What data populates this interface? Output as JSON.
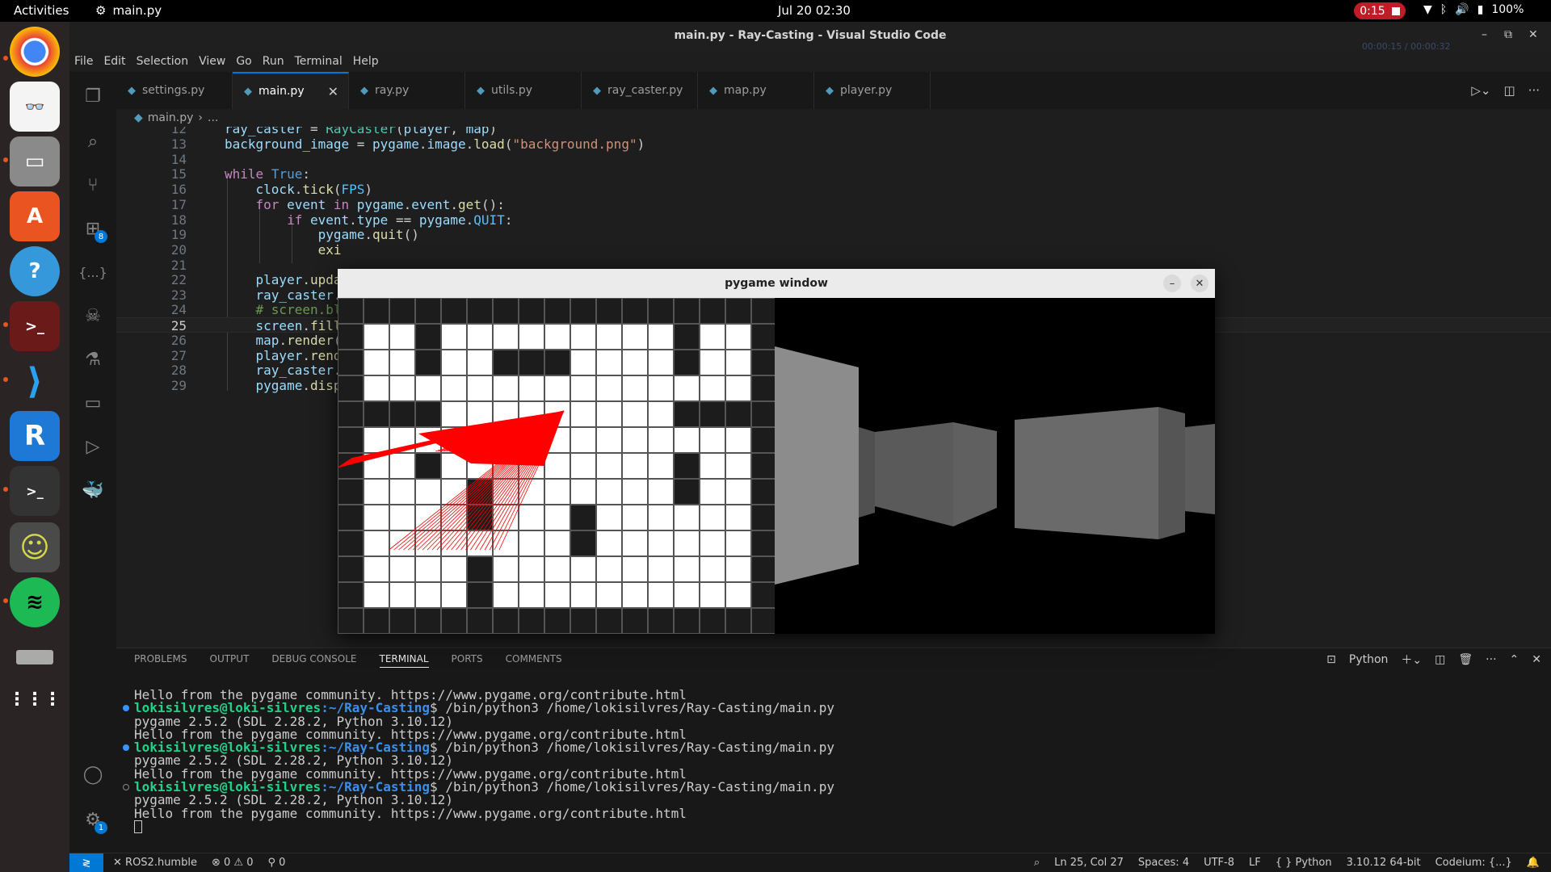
{
  "topbar": {
    "activities": "Activities",
    "app_name": "main.py",
    "clock": "Jul 20  02:30",
    "recording": "0:15",
    "battery": "100%"
  },
  "window": {
    "title": "main.py - Ray-Casting - Visual Studio Code",
    "timer": "00:00:15 / 00:00:32"
  },
  "menu": [
    "File",
    "Edit",
    "Selection",
    "View",
    "Go",
    "Run",
    "Terminal",
    "Help"
  ],
  "tabs": [
    "settings.py",
    "main.py",
    "ray.py",
    "utils.py",
    "ray_caster.py",
    "map.py",
    "player.py"
  ],
  "breadcrumb": {
    "file": "main.py",
    "more": "..."
  },
  "code": {
    "line_numbers": [
      "12",
      "13",
      "14",
      "15",
      "16",
      "17",
      "18",
      "19",
      "20",
      "21",
      "22",
      "23",
      "24",
      "25",
      "26",
      "27",
      "28",
      "29"
    ]
  },
  "pygame": {
    "title": "pygame window",
    "map": [
      "BBBBBBBBBBBBBBBBB",
      "BWWBWWWWWWWWWBWWB",
      "BWWBWWBBBWWWWBWWB",
      "BWWWWWWWWWWWWWWWB",
      "BBBBWWWWWWWWWBBBB",
      "BWWWWBWWWWWWWWWWB",
      "BWWBWWWWWWWWWBWWB",
      "BWWWWBWWWWWWWBWWB",
      "BWWWWBWWWBWWWWWWB",
      "BWWWWWWWWBWWWWWWB",
      "BWWWWBWWWWWWWWWWB",
      "BWWWWBWWWWWWWWWWB",
      "BBBBBBBBBBBBBBBBB"
    ]
  },
  "panel": {
    "tabs": [
      "PROBLEMS",
      "OUTPUT",
      "DEBUG CONSOLE",
      "TERMINAL",
      "PORTS",
      "COMMENTS"
    ],
    "shell": "Python"
  },
  "terminal": {
    "hello": "Hello from the pygame community. https://www.pygame.org/contribute.html",
    "user": "lokisilvres@loki-silvres",
    "path": ":~/Ray-Casting",
    "cmd": "$ /bin/python3 /home/lokisilvres/Ray-Casting/main.py",
    "version": "pygame 2.5.2 (SDL 2.28.2, Python 3.10.12)"
  },
  "status": {
    "ros": "ROS2.humble",
    "errors": "0",
    "warnings": "0",
    "ports": "0",
    "position": "Ln 25, Col 27",
    "spaces": "Spaces: 4",
    "encoding": "UTF-8",
    "eol": "LF",
    "language": "Python",
    "interpreter": "3.10.12 64-bit",
    "codeium": "Codeium: {...}"
  },
  "dock_icons": [
    "chrome-icon",
    "document-viewer-icon",
    "files-icon",
    "app-center-icon",
    "help-icon",
    "terminal-red-icon",
    "vscode-icon",
    "rustdesk-icon",
    "terminal-icon",
    "gnome-frog-icon",
    "spotify-icon",
    "drive-icon",
    "show-apps-icon"
  ]
}
